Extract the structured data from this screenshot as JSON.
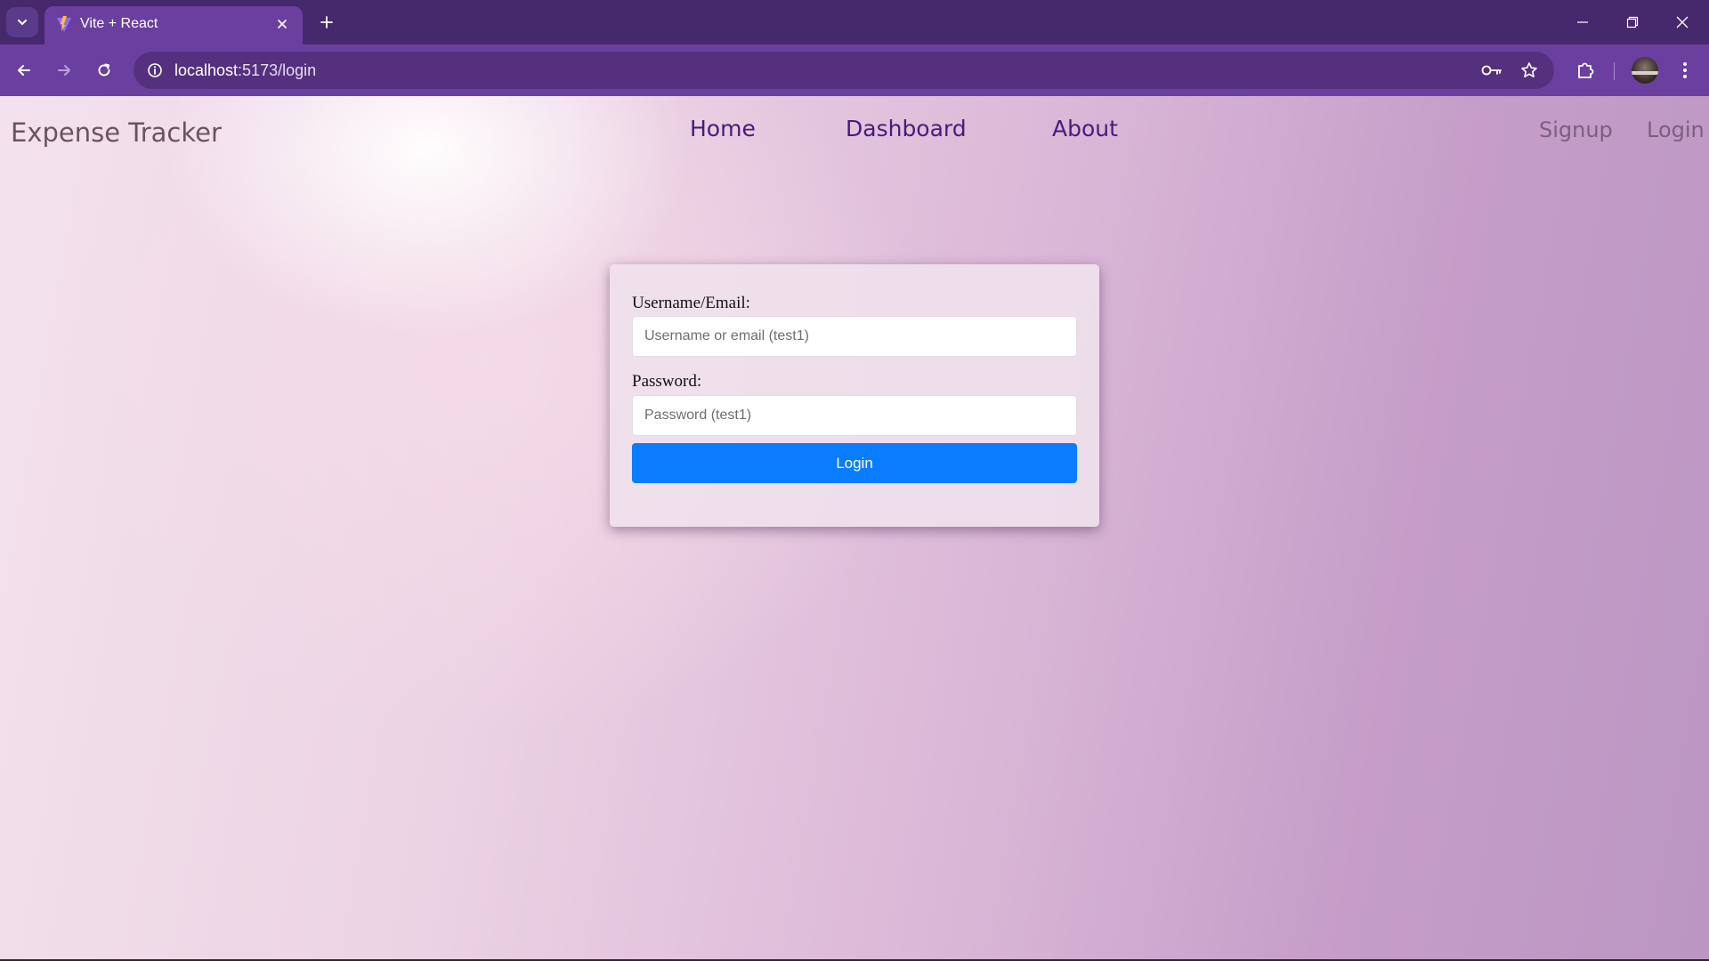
{
  "browser": {
    "tab_title": "Vite + React",
    "url_host": "localhost",
    "url_path": ":5173/login"
  },
  "nav": {
    "brand": "Expense Tracker",
    "links": [
      "Home",
      "Dashboard",
      "About"
    ],
    "signup": "Signup",
    "login": "Login"
  },
  "login_form": {
    "username_label": "Username/Email:",
    "username_placeholder": "Username or email (test1)",
    "password_label": "Password:",
    "password_placeholder": "Password (test1)",
    "submit_label": "Login"
  },
  "colors": {
    "browser_frame": "#46286c",
    "toolbar": "#6b3fa0",
    "nav_link": "#4a1a7a",
    "button_primary": "#0a7cff"
  }
}
